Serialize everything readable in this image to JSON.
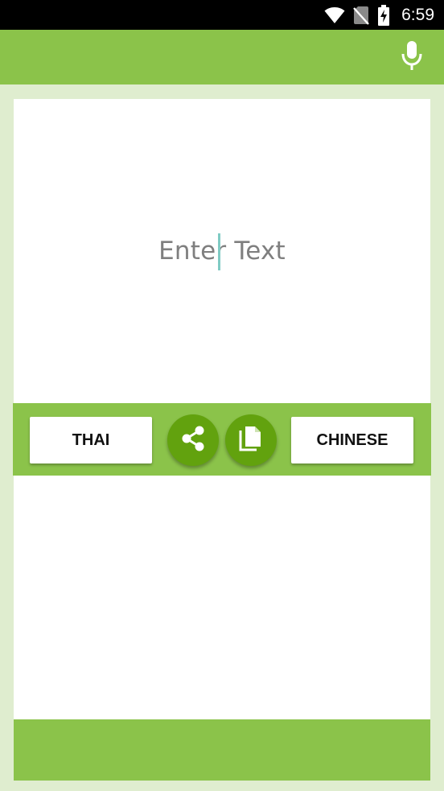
{
  "status_bar": {
    "time": "6:59",
    "icons": [
      "wifi-icon",
      "no-sim-icon",
      "battery-charging-icon"
    ]
  },
  "app_bar": {
    "mic_icon": "mic-icon"
  },
  "input": {
    "placeholder": "Enter Text",
    "value": ""
  },
  "controls": {
    "source_language": "THAI",
    "target_language": "CHINESE",
    "share_icon": "share-icon",
    "copy_icon": "copy-icon"
  },
  "output": {
    "text": ""
  },
  "colors": {
    "primary": "#8bc34a",
    "primary_dark": "#62a20e",
    "background": "#dfedcf",
    "caret": "#80cbc4"
  }
}
